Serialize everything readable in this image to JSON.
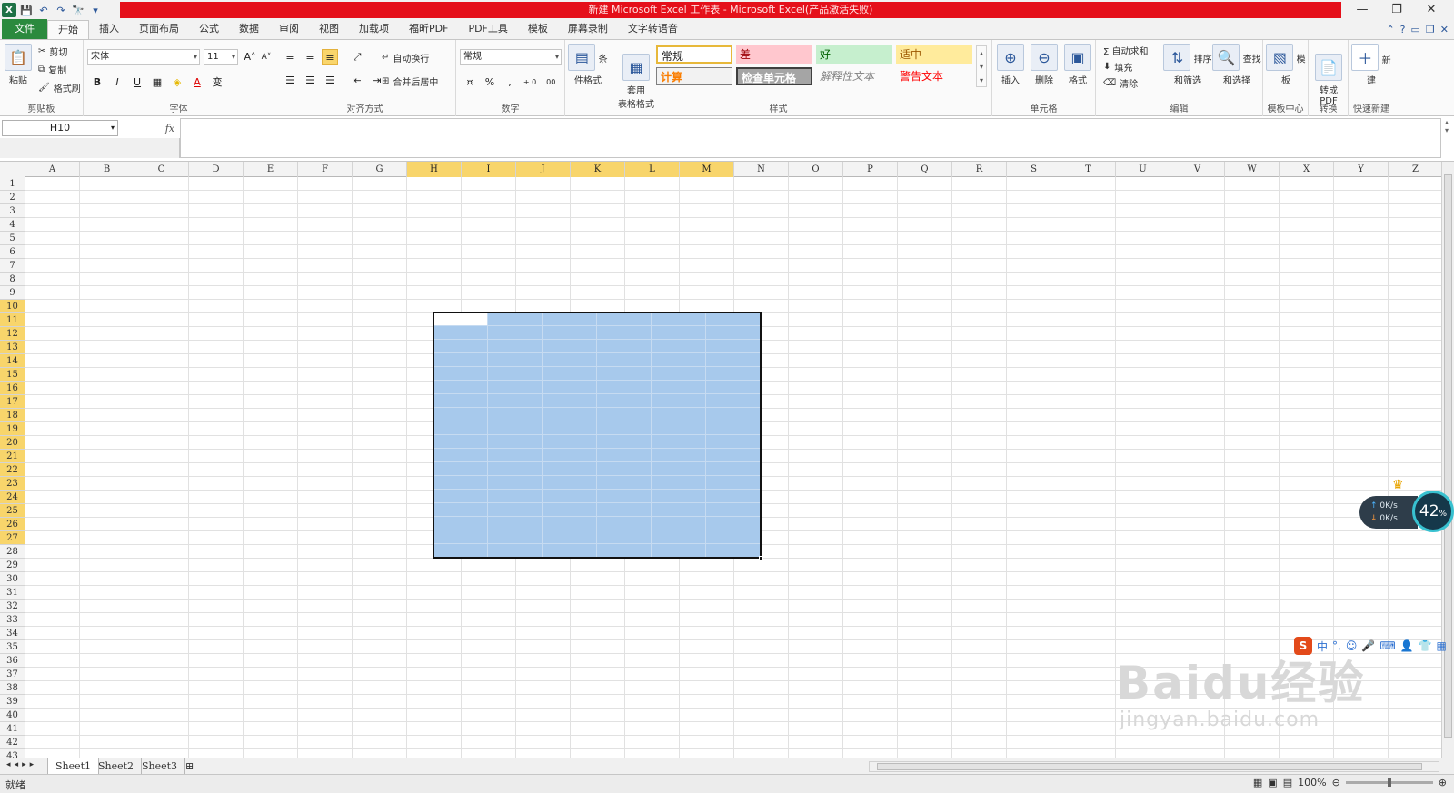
{
  "window": {
    "title": "新建 Microsoft Excel 工作表 - Microsoft Excel(产品激活失败)",
    "controls": [
      "—",
      "❐",
      "✕"
    ]
  },
  "quick_access": [
    "X",
    "💾",
    "↶",
    "↷",
    "🔭",
    "▾"
  ],
  "tabs": [
    "文件",
    "开始",
    "插入",
    "页面布局",
    "公式",
    "数据",
    "审阅",
    "视图",
    "加载项",
    "福昕PDF",
    "PDF工具",
    "模板",
    "屏幕录制",
    "文字转语音"
  ],
  "ribbon": {
    "clipboard": {
      "paste": "粘贴",
      "cut": "剪切",
      "copy": "复制",
      "format_painter": "格式刷",
      "label": "剪贴板"
    },
    "font": {
      "name": "宋体",
      "size": "11",
      "label": "字体",
      "bold": "B",
      "italic": "I",
      "underline": "U",
      "grow": "A˄",
      "shrink": "A˅",
      "phonetic": "变"
    },
    "alignment": {
      "wrap": "自动换行",
      "merge": "合并后居中",
      "label": "对齐方式"
    },
    "number": {
      "format": "常规",
      "percent": "%",
      "comma": ",",
      "label": "数字"
    },
    "styles": {
      "conditional": "条件格式",
      "table": "套用\n表格格式",
      "cells": [
        "常规",
        "差",
        "好",
        "适中",
        "计算",
        "检查单元格",
        "解释性文本",
        "警告文本"
      ],
      "label": "样式"
    },
    "cells": {
      "insert": "插入",
      "delete": "删除",
      "format": "格式",
      "label": "单元格"
    },
    "editing": {
      "autosum": "Σ 自动求和",
      "fill": "填充",
      "clear": "清除",
      "sort": "排序和筛选",
      "find": "查找和选择",
      "label": "编辑"
    },
    "template": {
      "button": "模板",
      "label": "模板中心"
    },
    "convert": {
      "button": "转成\nPDF",
      "label": "转换"
    },
    "quicknew": {
      "button": "新建",
      "label": "快速新建"
    }
  },
  "formula_bar": {
    "name_box": "H10",
    "fx": "fx",
    "content": ""
  },
  "columns": [
    "A",
    "B",
    "C",
    "D",
    "E",
    "F",
    "G",
    "H",
    "I",
    "J",
    "K",
    "L",
    "M",
    "N",
    "O",
    "P",
    "Q",
    "R",
    "S",
    "T",
    "U",
    "V",
    "W",
    "X",
    "Y",
    "Z"
  ],
  "selected_columns": [
    "H",
    "I",
    "J",
    "K",
    "L",
    "M"
  ],
  "rows": [
    "1",
    "2",
    "3",
    "4",
    "5",
    "6",
    "7",
    "8",
    "9",
    "10",
    "11",
    "12",
    "13",
    "14",
    "15",
    "16",
    "17",
    "18",
    "19",
    "20",
    "21",
    "22",
    "23",
    "24",
    "25",
    "26",
    "27",
    "28",
    "29",
    "30",
    "31",
    "32",
    "33",
    "34",
    "35",
    "36",
    "37",
    "38",
    "39",
    "40",
    "41",
    "42",
    "43"
  ],
  "selected_rows": {
    "from": 10,
    "to": 27
  },
  "sheets": [
    "Sheet1",
    "Sheet2",
    "Sheet3"
  ],
  "active_sheet": "Sheet1",
  "status": {
    "ready": "就绪",
    "zoom": "100%"
  },
  "net_widget": {
    "up": "0K/s",
    "down": "0K/s",
    "percent": "42"
  },
  "ime": {
    "logo": "S",
    "mode": "中"
  },
  "watermark": {
    "brand": "Baidu经验",
    "url": "jingyan.baidu.com"
  }
}
